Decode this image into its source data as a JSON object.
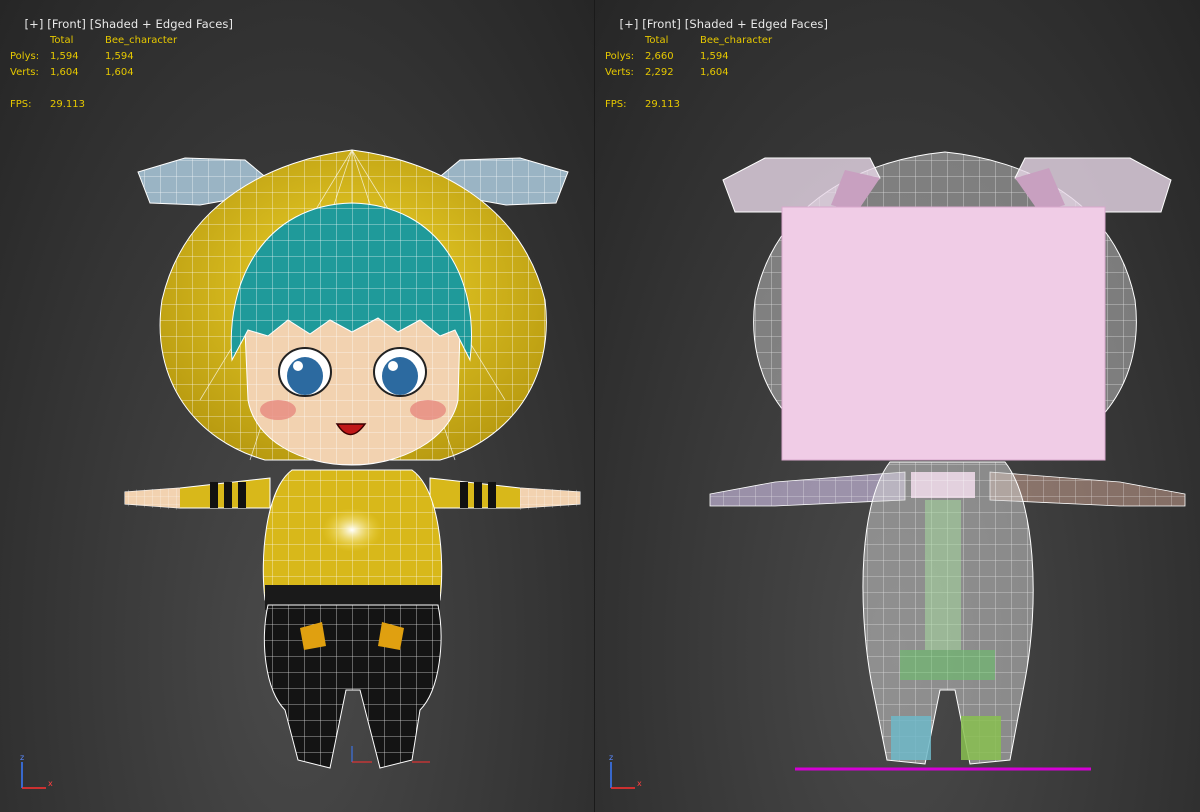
{
  "viewports": [
    {
      "label_plus": "[+]",
      "label_view": "[Front]",
      "label_mode": "[Shaded + Edged Faces]",
      "stats": {
        "col_total": "Total",
        "col_object": "Bee_character",
        "polys_label": "Polys:",
        "polys_total": "1,594",
        "polys_object": "1,594",
        "verts_label": "Verts:",
        "verts_total": "1,604",
        "verts_object": "1,604",
        "fps_label": "FPS:",
        "fps_value": "29.113"
      },
      "axis": {
        "z": "z",
        "x": "x"
      }
    },
    {
      "label_plus": "[+]",
      "label_view": "[Front]",
      "label_mode": "[Shaded + Edged Faces]",
      "stats": {
        "col_total": "Total",
        "col_object": "Bee_character",
        "polys_label": "Polys:",
        "polys_total": "2,660",
        "polys_object": "1,594",
        "verts_label": "Verts:",
        "verts_total": "2,292",
        "verts_object": "1,604",
        "fps_label": "FPS:",
        "fps_value": "29.113"
      },
      "axis": {
        "z": "z",
        "x": "x"
      }
    }
  ],
  "colors": {
    "stats_text": "#e6c800",
    "hood": "#d8b81a",
    "hair": "#1f9a9a",
    "antenna": "#9ab4c4",
    "skin": "#f2d2b0",
    "pants": "#141414",
    "ghost_mesh": "#d6d6d6",
    "pink_plane": "#f0cce6",
    "ground_line": "#d400d4"
  }
}
